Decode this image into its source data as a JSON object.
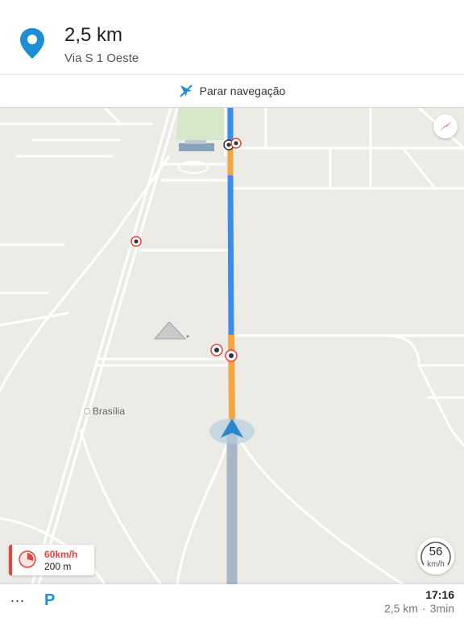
{
  "header": {
    "distance": "2,5 km",
    "street": "Via S 1 Oeste",
    "pin_icon": "location-pin-icon",
    "pin_color": "#1e8fd6"
  },
  "stop_navigation": {
    "label": "Parar navegação",
    "icon": "stop-navigation-icon"
  },
  "map": {
    "city_label": "Brasília",
    "route_colors": {
      "free": "#3b8cf0",
      "slow": "#f5a542",
      "passed": "#a9b7c9"
    }
  },
  "speed_limit": {
    "limit": "60km/h",
    "distance": "200 m",
    "accent": "#e5443b"
  },
  "speedometer": {
    "value": "56",
    "unit": "km/h"
  },
  "bottom_bar": {
    "more_label": "...",
    "parking_label": "P",
    "eta": "17:16",
    "remaining_distance": "2,5 km",
    "separator": "·",
    "remaining_time": "3min"
  }
}
